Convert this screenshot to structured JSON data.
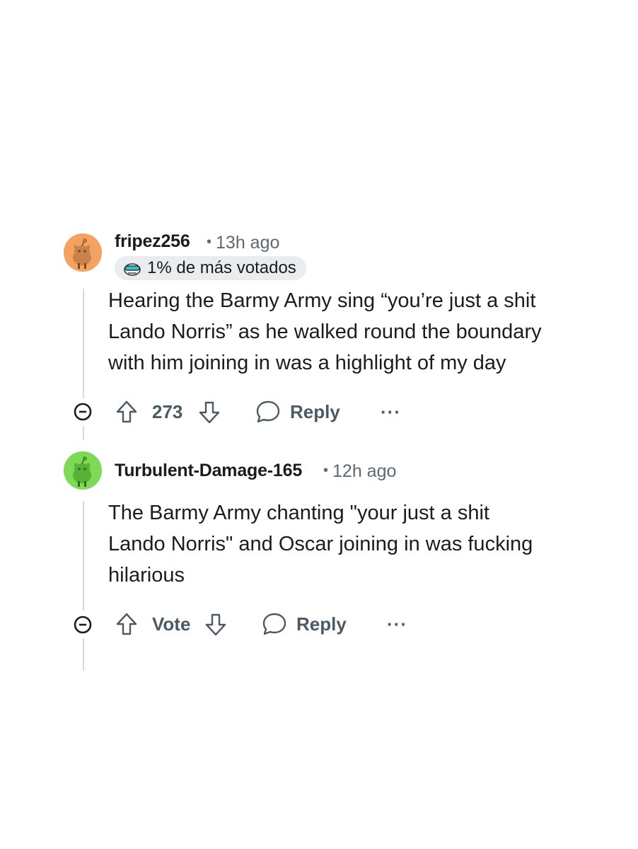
{
  "comments": [
    {
      "username": "fripez256",
      "time": "13h ago",
      "flair": "1% de más votados",
      "body_lines": [
        "Hearing the Barmy Army sing “you’re just a shit",
        "Lando Norris” as he walked round the boundary",
        "with him joining in was a highlight of my day"
      ],
      "vote_label": "273",
      "reply_label": "Reply",
      "more_label": "···",
      "avatar_color": "#f4a261"
    },
    {
      "username": "Turbulent-Damage-165",
      "time": "12h ago",
      "body_lines": [
        "The Barmy Army chanting \"your just a shit",
        "Lando Norris\" and Oscar joining in was fucking",
        "hilarious"
      ],
      "vote_label": "Vote",
      "reply_label": "Reply",
      "more_label": "···",
      "avatar_color": "#7ed957"
    }
  ],
  "icons": {
    "collapse": "minus-circle-icon",
    "upvote": "arrow-up-icon",
    "downvote": "arrow-down-icon",
    "reply": "speech-bubble-icon",
    "flair": "snoo-goggles-icon"
  },
  "colors": {
    "text": "#1c1c1c",
    "muted": "#5c6a73",
    "action": "#4c5a63",
    "thread": "#d6dade",
    "flair_bg": "#e9edf0"
  }
}
